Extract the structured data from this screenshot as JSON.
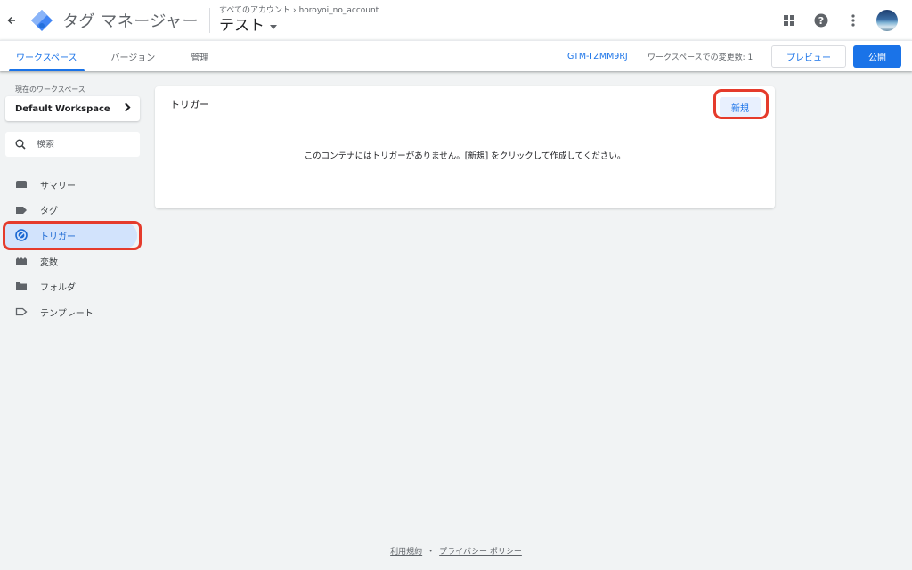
{
  "header": {
    "app_title": "タグ マネージャー",
    "breadcrumb_account_prefix": "すべてのアカウント",
    "breadcrumb_account": "horoyoi_no_account",
    "container_name": "テスト"
  },
  "icons": {
    "back": "arrow-left-icon",
    "logo": "gtm-diamond-logo",
    "apps": "apps-grid-icon",
    "help": "help-circle-icon",
    "more": "more-vert-icon",
    "avatar": "user-avatar"
  },
  "subnav": {
    "tabs": [
      {
        "label": "ワークスペース",
        "active": true
      },
      {
        "label": "バージョン",
        "active": false
      },
      {
        "label": "管理",
        "active": false
      }
    ],
    "container_id": "GTM-TZMM9RJ",
    "changes_text": "ワークスペースでの変更数: 1",
    "preview_label": "プレビュー",
    "publish_label": "公開"
  },
  "sidebar": {
    "workspace_label": "現在のワークスペース",
    "workspace_name": "Default Workspace",
    "search_placeholder": "検索",
    "items": [
      {
        "label": "サマリー",
        "icon": "summary-icon",
        "active": false
      },
      {
        "label": "タグ",
        "icon": "tag-icon",
        "active": false
      },
      {
        "label": "トリガー",
        "icon": "trigger-icon",
        "active": true
      },
      {
        "label": "変数",
        "icon": "variables-icon",
        "active": false
      },
      {
        "label": "フォルダ",
        "icon": "folder-icon",
        "active": false
      },
      {
        "label": "テンプレート",
        "icon": "template-icon",
        "active": false
      }
    ]
  },
  "main": {
    "card_title": "トリガー",
    "new_button": "新規",
    "empty_message": "このコンテナにはトリガーがありません。[新規] をクリックして作成してください。"
  },
  "footer": {
    "terms": "利用規約",
    "separator": "・",
    "privacy": "プライバシー ポリシー"
  },
  "colors": {
    "accent": "#1a73e8",
    "highlight": "#e53b2c",
    "active_nav_bg": "#d2e3fc",
    "page_bg": "#f1f3f4"
  }
}
